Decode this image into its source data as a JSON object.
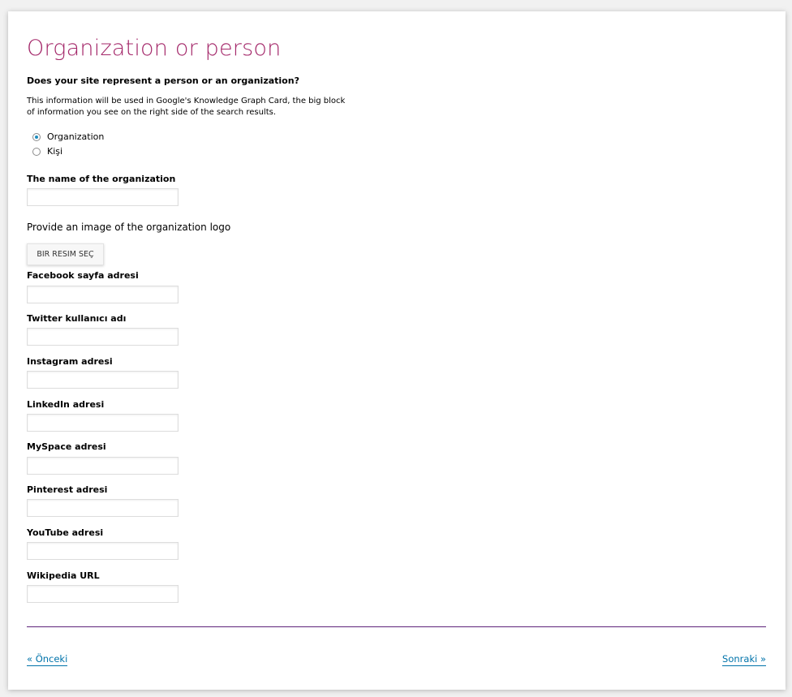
{
  "page": {
    "title": "Organization or person",
    "question": "Does your site represent a person or an organization?",
    "description": "This information will be used in Google's Knowledge Graph Card, the big block of information you see on the right side of the search results."
  },
  "radio_options": [
    {
      "label": "Organization",
      "checked": true
    },
    {
      "label": "Kişi",
      "checked": false
    }
  ],
  "organization_name": {
    "label": "The name of the organization",
    "value": ""
  },
  "logo": {
    "prompt": "Provide an image of the organization logo",
    "button_label": "BIR RESIM SEÇ"
  },
  "social_fields": [
    {
      "label": "Facebook sayfa adresi",
      "value": ""
    },
    {
      "label": "Twitter kullanıcı adı",
      "value": ""
    },
    {
      "label": "Instagram adresi",
      "value": ""
    },
    {
      "label": "LinkedIn adresi",
      "value": ""
    },
    {
      "label": "MySpace adresi",
      "value": ""
    },
    {
      "label": "Pinterest adresi",
      "value": ""
    },
    {
      "label": "YouTube adresi",
      "value": ""
    },
    {
      "label": "Wikipedia URL",
      "value": ""
    }
  ],
  "navigation": {
    "prev_label": "« Önceki",
    "next_label": "Sonraki »"
  },
  "colors": {
    "title": "#a4286a",
    "link": "#0073aa",
    "divider": "#5d237a",
    "radio_selected": "#1e8cbe"
  }
}
